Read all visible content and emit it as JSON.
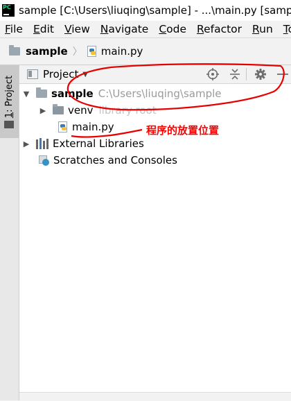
{
  "window": {
    "title": "sample [C:\\Users\\liuqing\\sample] - ...\\main.py [sample]"
  },
  "menu": {
    "items": [
      {
        "u": "F",
        "rest": "ile"
      },
      {
        "u": "E",
        "rest": "dit"
      },
      {
        "u": "V",
        "rest": "iew"
      },
      {
        "u": "N",
        "rest": "avigate"
      },
      {
        "u": "C",
        "rest": "ode"
      },
      {
        "u": "R",
        "rest": "efactor"
      },
      {
        "u": "R",
        "rest": "un"
      },
      {
        "u": "T",
        "rest": "oo"
      }
    ]
  },
  "breadcrumb": {
    "project": "sample",
    "file": "main.py"
  },
  "side_tab": {
    "number": "1",
    "label": ": Project"
  },
  "panel": {
    "title": "Project"
  },
  "tree": {
    "root": {
      "name": "sample",
      "path": "C:\\Users\\liuqing\\sample"
    },
    "venv": {
      "name": "venv",
      "hint": "library root"
    },
    "main": {
      "name": "main.py"
    },
    "external": {
      "name": "External Libraries"
    },
    "scratches": {
      "name": "Scratches and Consoles"
    }
  },
  "annotation": {
    "text": "程序的放置位置",
    "color": "#ff0000"
  },
  "colors": {
    "folder": "#9aa7b0",
    "annotation": "#ff0000"
  }
}
